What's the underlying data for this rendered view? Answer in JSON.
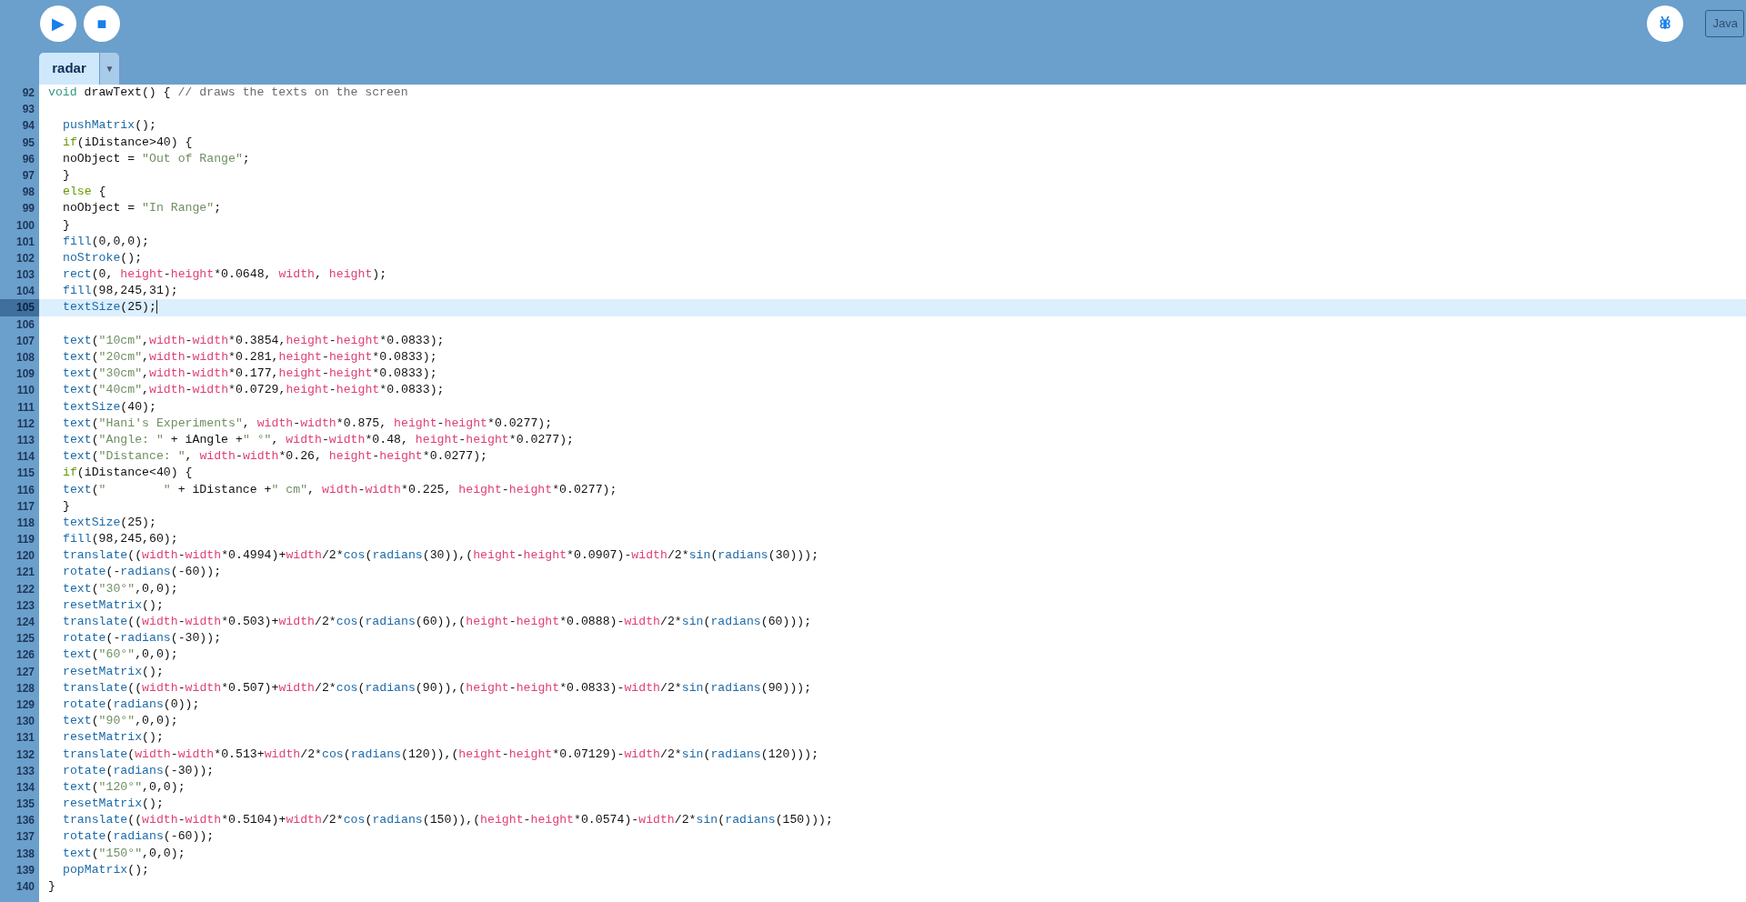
{
  "toolbar": {
    "run_button": "▶",
    "stop_button": "■",
    "mode": "Java"
  },
  "tabs": [
    {
      "label": "radar",
      "selected": true,
      "menu": "▼"
    }
  ],
  "editor": {
    "lines": [
      {
        "num": "92",
        "current": false,
        "indented": false,
        "tokens": [
          {
            "kind": "type",
            "text": "void"
          },
          " drawText() { ",
          {
            "kind": "cmt",
            "text": "// draws the texts on the screen"
          }
        ]
      },
      {
        "num": "93",
        "current": false
      },
      {
        "num": "94",
        "current": false,
        "indented": true,
        "tokens": [
          {
            "kind": "fn",
            "text": "pushMatrix"
          },
          "();"
        ]
      },
      {
        "num": "95",
        "current": false,
        "indented": true,
        "tokens": [
          {
            "kind": "ctrl",
            "text": "if"
          },
          "(iDistance>40) {"
        ]
      },
      {
        "num": "96",
        "current": false,
        "indented": true,
        "tokens": [
          "noObject = ",
          {
            "kind": "str",
            "text": "\"Out of Range\""
          },
          ";"
        ]
      },
      {
        "num": "97",
        "current": false,
        "indented": true,
        "tokens": [
          "}"
        ]
      },
      {
        "num": "98",
        "current": false,
        "indented": true,
        "tokens": [
          {
            "kind": "ctrl",
            "text": "else"
          },
          " {"
        ]
      },
      {
        "num": "99",
        "current": false,
        "indented": true,
        "tokens": [
          "noObject = ",
          {
            "kind": "str",
            "text": "\"In Range\""
          },
          ";"
        ]
      },
      {
        "num": "100",
        "current": false,
        "indented": true,
        "tokens": [
          "}"
        ]
      },
      {
        "num": "101",
        "current": false,
        "indented": true,
        "tokens": [
          {
            "kind": "fn",
            "text": "fill"
          },
          "(0,0,0);"
        ]
      },
      {
        "num": "102",
        "current": false,
        "indented": true,
        "tokens": [
          {
            "kind": "fn",
            "text": "noStroke"
          },
          "();"
        ]
      },
      {
        "num": "103",
        "current": false,
        "indented": true,
        "tokens": [
          {
            "kind": "fn",
            "text": "rect"
          },
          "(0, ",
          {
            "kind": "var",
            "text": "height"
          },
          "-",
          {
            "kind": "var",
            "text": "height"
          },
          "*0.0648, ",
          {
            "kind": "var",
            "text": "width"
          },
          ", ",
          {
            "kind": "var",
            "text": "height"
          },
          ");"
        ]
      },
      {
        "num": "104",
        "current": false,
        "indented": true,
        "tokens": [
          {
            "kind": "fn",
            "text": "fill"
          },
          "(98,245,31);"
        ]
      },
      {
        "num": "105",
        "current": true,
        "indented": true,
        "tokens": [
          {
            "kind": "fn",
            "text": "textSize"
          },
          "(25);"
        ]
      },
      {
        "num": "106",
        "current": false
      },
      {
        "num": "107",
        "current": false,
        "indented": true,
        "tokens": [
          {
            "kind": "fn",
            "text": "text"
          },
          "(",
          {
            "kind": "str",
            "text": "\"10cm\""
          },
          ",",
          {
            "kind": "var",
            "text": "width"
          },
          "-",
          {
            "kind": "var",
            "text": "width"
          },
          "*0.3854,",
          {
            "kind": "var",
            "text": "height"
          },
          "-",
          {
            "kind": "var",
            "text": "height"
          },
          "*0.0833);"
        ]
      },
      {
        "num": "108",
        "current": false,
        "indented": true,
        "tokens": [
          {
            "kind": "fn",
            "text": "text"
          },
          "(",
          {
            "kind": "str",
            "text": "\"20cm\""
          },
          ",",
          {
            "kind": "var",
            "text": "width"
          },
          "-",
          {
            "kind": "var",
            "text": "width"
          },
          "*0.281,",
          {
            "kind": "var",
            "text": "height"
          },
          "-",
          {
            "kind": "var",
            "text": "height"
          },
          "*0.0833);"
        ]
      },
      {
        "num": "109",
        "current": false,
        "indented": true,
        "tokens": [
          {
            "kind": "fn",
            "text": "text"
          },
          "(",
          {
            "kind": "str",
            "text": "\"30cm\""
          },
          ",",
          {
            "kind": "var",
            "text": "width"
          },
          "-",
          {
            "kind": "var",
            "text": "width"
          },
          "*0.177,",
          {
            "kind": "var",
            "text": "height"
          },
          "-",
          {
            "kind": "var",
            "text": "height"
          },
          "*0.0833);"
        ]
      },
      {
        "num": "110",
        "current": false,
        "indented": true,
        "tokens": [
          {
            "kind": "fn",
            "text": "text"
          },
          "(",
          {
            "kind": "str",
            "text": "\"40cm\""
          },
          ",",
          {
            "kind": "var",
            "text": "width"
          },
          "-",
          {
            "kind": "var",
            "text": "width"
          },
          "*0.0729,",
          {
            "kind": "var",
            "text": "height"
          },
          "-",
          {
            "kind": "var",
            "text": "height"
          },
          "*0.0833);"
        ]
      },
      {
        "num": "111",
        "current": false,
        "indented": true,
        "tokens": [
          {
            "kind": "fn",
            "text": "textSize"
          },
          "(40);"
        ]
      },
      {
        "num": "112",
        "current": false,
        "indented": true,
        "tokens": [
          {
            "kind": "fn",
            "text": "text"
          },
          "(",
          {
            "kind": "str",
            "text": "\"Hani's Experiments\""
          },
          ", ",
          {
            "kind": "var",
            "text": "width"
          },
          "-",
          {
            "kind": "var",
            "text": "width"
          },
          "*0.875, ",
          {
            "kind": "var",
            "text": "height"
          },
          "-",
          {
            "kind": "var",
            "text": "height"
          },
          "*0.0277);"
        ]
      },
      {
        "num": "113",
        "current": false,
        "indented": true,
        "tokens": [
          {
            "kind": "fn",
            "text": "text"
          },
          "(",
          {
            "kind": "str",
            "text": "\"Angle: \""
          },
          " + iAngle +",
          {
            "kind": "str",
            "text": "\" °\""
          },
          ", ",
          {
            "kind": "var",
            "text": "width"
          },
          "-",
          {
            "kind": "var",
            "text": "width"
          },
          "*0.48, ",
          {
            "kind": "var",
            "text": "height"
          },
          "-",
          {
            "kind": "var",
            "text": "height"
          },
          "*0.0277);"
        ]
      },
      {
        "num": "114",
        "current": false,
        "indented": true,
        "tokens": [
          {
            "kind": "fn",
            "text": "text"
          },
          "(",
          {
            "kind": "str",
            "text": "\"Distance: \""
          },
          ", ",
          {
            "kind": "var",
            "text": "width"
          },
          "-",
          {
            "kind": "var",
            "text": "width"
          },
          "*0.26, ",
          {
            "kind": "var",
            "text": "height"
          },
          "-",
          {
            "kind": "var",
            "text": "height"
          },
          "*0.0277);"
        ]
      },
      {
        "num": "115",
        "current": false,
        "indented": true,
        "tokens": [
          {
            "kind": "ctrl",
            "text": "if"
          },
          "(iDistance<40) {"
        ]
      },
      {
        "num": "116",
        "current": false,
        "indented": true,
        "tokens": [
          {
            "kind": "fn",
            "text": "text"
          },
          "(",
          {
            "kind": "str",
            "text": "\"        \""
          },
          " + iDistance +",
          {
            "kind": "str",
            "text": "\" cm\""
          },
          ", ",
          {
            "kind": "var",
            "text": "width"
          },
          "-",
          {
            "kind": "var",
            "text": "width"
          },
          "*0.225, ",
          {
            "kind": "var",
            "text": "height"
          },
          "-",
          {
            "kind": "var",
            "text": "height"
          },
          "*0.0277);"
        ]
      },
      {
        "num": "117",
        "current": false,
        "indented": true,
        "tokens": [
          "}"
        ]
      },
      {
        "num": "118",
        "current": false,
        "indented": true,
        "tokens": [
          {
            "kind": "fn",
            "text": "textSize"
          },
          "(25);"
        ]
      },
      {
        "num": "119",
        "current": false,
        "indented": true,
        "tokens": [
          {
            "kind": "fn",
            "text": "fill"
          },
          "(98,245,60);"
        ]
      },
      {
        "num": "120",
        "current": false,
        "indented": true,
        "tokens": [
          {
            "kind": "fn",
            "text": "translate"
          },
          "((",
          {
            "kind": "var",
            "text": "width"
          },
          "-",
          {
            "kind": "var",
            "text": "width"
          },
          "*0.4994)+",
          {
            "kind": "var",
            "text": "width"
          },
          "/2*",
          {
            "kind": "fn",
            "text": "cos"
          },
          "(",
          {
            "kind": "fn",
            "text": "radians"
          },
          "(30)),(",
          {
            "kind": "var",
            "text": "height"
          },
          "-",
          {
            "kind": "var",
            "text": "height"
          },
          "*0.0907)-",
          {
            "kind": "var",
            "text": "width"
          },
          "/2*",
          {
            "kind": "fn",
            "text": "sin"
          },
          "(",
          {
            "kind": "fn",
            "text": "radians"
          },
          "(30)));"
        ]
      },
      {
        "num": "121",
        "current": false,
        "indented": true,
        "tokens": [
          {
            "kind": "fn",
            "text": "rotate"
          },
          "(-",
          {
            "kind": "fn",
            "text": "radians"
          },
          "(-60));"
        ]
      },
      {
        "num": "122",
        "current": false,
        "indented": true,
        "tokens": [
          {
            "kind": "fn",
            "text": "text"
          },
          "(",
          {
            "kind": "str",
            "text": "\"30°\""
          },
          ",0,0);"
        ]
      },
      {
        "num": "123",
        "current": false,
        "indented": true,
        "tokens": [
          {
            "kind": "fn",
            "text": "resetMatrix"
          },
          "();"
        ]
      },
      {
        "num": "124",
        "current": false,
        "indented": true,
        "tokens": [
          {
            "kind": "fn",
            "text": "translate"
          },
          "((",
          {
            "kind": "var",
            "text": "width"
          },
          "-",
          {
            "kind": "var",
            "text": "width"
          },
          "*0.503)+",
          {
            "kind": "var",
            "text": "width"
          },
          "/2*",
          {
            "kind": "fn",
            "text": "cos"
          },
          "(",
          {
            "kind": "fn",
            "text": "radians"
          },
          "(60)),(",
          {
            "kind": "var",
            "text": "height"
          },
          "-",
          {
            "kind": "var",
            "text": "height"
          },
          "*0.0888)-",
          {
            "kind": "var",
            "text": "width"
          },
          "/2*",
          {
            "kind": "fn",
            "text": "sin"
          },
          "(",
          {
            "kind": "fn",
            "text": "radians"
          },
          "(60)));"
        ]
      },
      {
        "num": "125",
        "current": false,
        "indented": true,
        "tokens": [
          {
            "kind": "fn",
            "text": "rotate"
          },
          "(-",
          {
            "kind": "fn",
            "text": "radians"
          },
          "(-30));"
        ]
      },
      {
        "num": "126",
        "current": false,
        "indented": true,
        "tokens": [
          {
            "kind": "fn",
            "text": "text"
          },
          "(",
          {
            "kind": "str",
            "text": "\"60°\""
          },
          ",0,0);"
        ]
      },
      {
        "num": "127",
        "current": false,
        "indented": true,
        "tokens": [
          {
            "kind": "fn",
            "text": "resetMatrix"
          },
          "();"
        ]
      },
      {
        "num": "128",
        "current": false,
        "indented": true,
        "tokens": [
          {
            "kind": "fn",
            "text": "translate"
          },
          "((",
          {
            "kind": "var",
            "text": "width"
          },
          "-",
          {
            "kind": "var",
            "text": "width"
          },
          "*0.507)+",
          {
            "kind": "var",
            "text": "width"
          },
          "/2*",
          {
            "kind": "fn",
            "text": "cos"
          },
          "(",
          {
            "kind": "fn",
            "text": "radians"
          },
          "(90)),(",
          {
            "kind": "var",
            "text": "height"
          },
          "-",
          {
            "kind": "var",
            "text": "height"
          },
          "*0.0833)-",
          {
            "kind": "var",
            "text": "width"
          },
          "/2*",
          {
            "kind": "fn",
            "text": "sin"
          },
          "(",
          {
            "kind": "fn",
            "text": "radians"
          },
          "(90)));"
        ]
      },
      {
        "num": "129",
        "current": false,
        "indented": true,
        "tokens": [
          {
            "kind": "fn",
            "text": "rotate"
          },
          "(",
          {
            "kind": "fn",
            "text": "radians"
          },
          "(0));"
        ]
      },
      {
        "num": "130",
        "current": false,
        "indented": true,
        "tokens": [
          {
            "kind": "fn",
            "text": "text"
          },
          "(",
          {
            "kind": "str",
            "text": "\"90°\""
          },
          ",0,0);"
        ]
      },
      {
        "num": "131",
        "current": false,
        "indented": true,
        "tokens": [
          {
            "kind": "fn",
            "text": "resetMatrix"
          },
          "();"
        ]
      },
      {
        "num": "132",
        "current": false,
        "indented": true,
        "tokens": [
          {
            "kind": "fn",
            "text": "translate"
          },
          "(",
          {
            "kind": "var",
            "text": "width"
          },
          "-",
          {
            "kind": "var",
            "text": "width"
          },
          "*0.513+",
          {
            "kind": "var",
            "text": "width"
          },
          "/2*",
          {
            "kind": "fn",
            "text": "cos"
          },
          "(",
          {
            "kind": "fn",
            "text": "radians"
          },
          "(120)),(",
          {
            "kind": "var",
            "text": "height"
          },
          "-",
          {
            "kind": "var",
            "text": "height"
          },
          "*0.07129)-",
          {
            "kind": "var",
            "text": "width"
          },
          "/2*",
          {
            "kind": "fn",
            "text": "sin"
          },
          "(",
          {
            "kind": "fn",
            "text": "radians"
          },
          "(120)));"
        ]
      },
      {
        "num": "133",
        "current": false,
        "indented": true,
        "tokens": [
          {
            "kind": "fn",
            "text": "rotate"
          },
          "(",
          {
            "kind": "fn",
            "text": "radians"
          },
          "(-30));"
        ]
      },
      {
        "num": "134",
        "current": false,
        "indented": true,
        "tokens": [
          {
            "kind": "fn",
            "text": "text"
          },
          "(",
          {
            "kind": "str",
            "text": "\"120°\""
          },
          ",0,0);"
        ]
      },
      {
        "num": "135",
        "current": false,
        "indented": true,
        "tokens": [
          {
            "kind": "fn",
            "text": "resetMatrix"
          },
          "();"
        ]
      },
      {
        "num": "136",
        "current": false,
        "indented": true,
        "tokens": [
          {
            "kind": "fn",
            "text": "translate"
          },
          "((",
          {
            "kind": "var",
            "text": "width"
          },
          "-",
          {
            "kind": "var",
            "text": "width"
          },
          "*0.5104)+",
          {
            "kind": "var",
            "text": "width"
          },
          "/2*",
          {
            "kind": "fn",
            "text": "cos"
          },
          "(",
          {
            "kind": "fn",
            "text": "radians"
          },
          "(150)),(",
          {
            "kind": "var",
            "text": "height"
          },
          "-",
          {
            "kind": "var",
            "text": "height"
          },
          "*0.0574)-",
          {
            "kind": "var",
            "text": "width"
          },
          "/2*",
          {
            "kind": "fn",
            "text": "sin"
          },
          "(",
          {
            "kind": "fn",
            "text": "radians"
          },
          "(150)));"
        ]
      },
      {
        "num": "137",
        "current": false,
        "indented": true,
        "tokens": [
          {
            "kind": "fn",
            "text": "rotate"
          },
          "(",
          {
            "kind": "fn",
            "text": "radians"
          },
          "(-60));"
        ]
      },
      {
        "num": "138",
        "current": false,
        "indented": true,
        "tokens": [
          {
            "kind": "fn",
            "text": "text"
          },
          "(",
          {
            "kind": "str",
            "text": "\"150°\""
          },
          ",0,0);"
        ]
      },
      {
        "num": "139",
        "current": false,
        "indented": true,
        "tokens": [
          {
            "kind": "fn",
            "text": "popMatrix"
          },
          "();"
        ]
      },
      {
        "num": "140",
        "current": false,
        "indented": false,
        "tokens": [
          "}"
        ]
      }
    ]
  }
}
